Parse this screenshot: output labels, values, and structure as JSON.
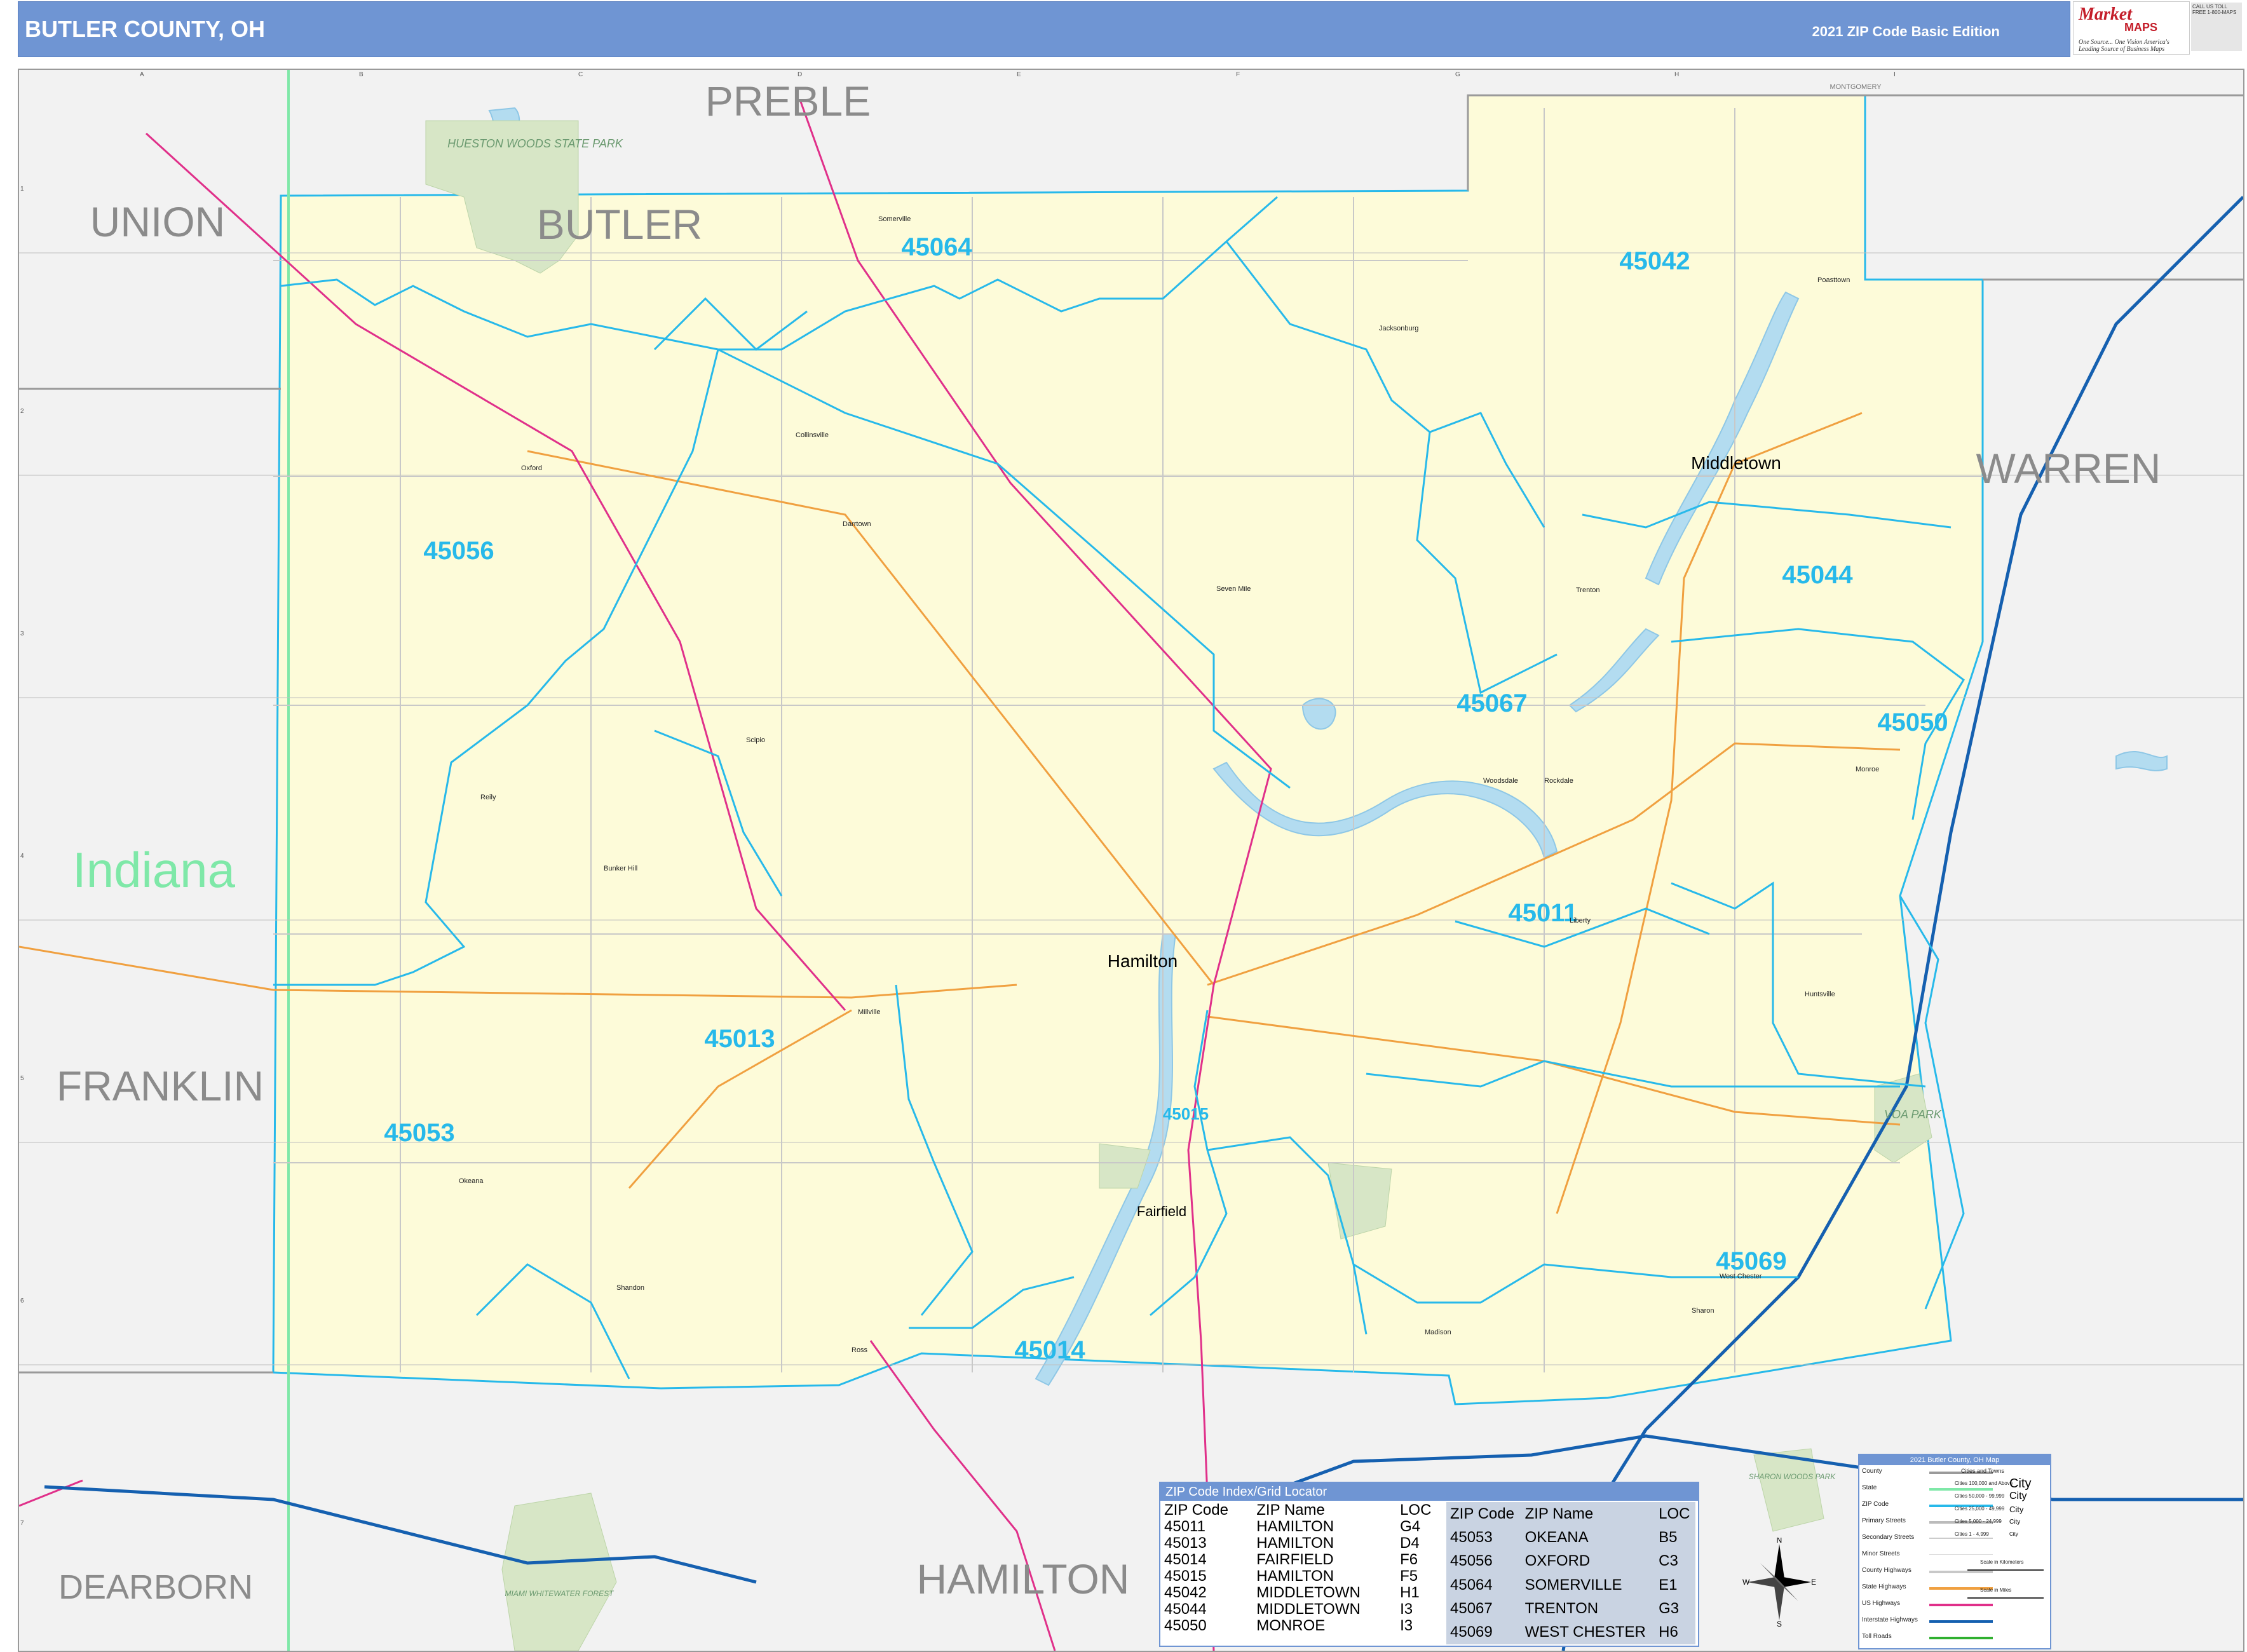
{
  "header": {
    "title": "BUTLER COUNTY, OH",
    "edition": "2021 ZIP Code Basic Edition"
  },
  "logo": {
    "brand_letter": "Market",
    "brand_maps": "MAPS",
    "tagline": "One Source... One Vision",
    "subline": "America's Leading Source of Business Maps",
    "contact": "CALL US TOLL FREE 1-800-MAPS"
  },
  "map": {
    "background_color": "#f2f2f2",
    "county_fill": "#fdfbd9",
    "zip_line_color": "#27b9ea",
    "water_color": "#b3dcf0",
    "park_color": "#d7e6c6",
    "counties": {
      "preble": "PREBLE",
      "union": "UNION",
      "butler": "BUTLER",
      "warren": "WARREN",
      "franklin": "FRANKLIN",
      "dearborn": "DEARBORN",
      "hamilton": "HAMILTON",
      "montgomery": "MONTGOMERY"
    },
    "state": "Indiana",
    "zips": [
      "45064",
      "45042",
      "45056",
      "45044",
      "45067",
      "45050",
      "45011",
      "45013",
      "45053",
      "45015",
      "45069",
      "45014"
    ],
    "cities": {
      "hamilton": "Hamilton",
      "middletown": "Middletown",
      "fairfield": "Fairfield"
    },
    "towns": [
      "Oxford",
      "Somerville",
      "Trenton",
      "Monroe",
      "West Chester",
      "Seven Mile",
      "Millville",
      "Shandon",
      "Okeana",
      "Ross",
      "Darrtown",
      "Collinsville",
      "Jacksonburg",
      "Madison",
      "Liberty",
      "Bunker Hill",
      "Reily",
      "Scipio",
      "Poasttown",
      "Huntsville",
      "Sharon",
      "Woodsdale",
      "Rockdale"
    ],
    "parks": {
      "hueston": "HUESTON WOODS STATE PARK",
      "voa": "VOA PARK",
      "sharon": "SHARON WOODS PARK",
      "miami": "MIAMI WHITEWATER FOREST"
    },
    "grid_letters": [
      "A",
      "B",
      "C",
      "D",
      "E",
      "F",
      "G",
      "H",
      "I"
    ],
    "grid_numbers": [
      "1",
      "2",
      "3",
      "4",
      "5",
      "6",
      "7"
    ]
  },
  "zip_index": {
    "title": "ZIP Code Index/Grid Locator",
    "headers": [
      "ZIP Code",
      "ZIP Name",
      "LOC"
    ],
    "left": [
      [
        "45011",
        "HAMILTON",
        "G4"
      ],
      [
        "45013",
        "HAMILTON",
        "D4"
      ],
      [
        "45014",
        "FAIRFIELD",
        "F6"
      ],
      [
        "45015",
        "HAMILTON",
        "F5"
      ],
      [
        "45042",
        "MIDDLETOWN",
        "H1"
      ],
      [
        "45044",
        "MIDDLETOWN",
        "I3"
      ],
      [
        "45050",
        "MONROE",
        "I3"
      ]
    ],
    "right": [
      [
        "45053",
        "OKEANA",
        "B5"
      ],
      [
        "45056",
        "OXFORD",
        "C3"
      ],
      [
        "45064",
        "SOMERVILLE",
        "E1"
      ],
      [
        "45067",
        "TRENTON",
        "G3"
      ],
      [
        "45069",
        "WEST CHESTER",
        "H6"
      ]
    ]
  },
  "legend": {
    "title": "2021 Butler County, OH Map",
    "rows": [
      "County",
      "State",
      "ZIP Code",
      "Primary Streets",
      "Secondary Streets",
      "Minor Streets",
      "County Highways",
      "State Highways",
      "US Highways",
      "Interstate Highways",
      "Toll Roads"
    ],
    "cities_header": "Cities and Towns",
    "city_tiers": [
      "Cities 100,000 and Above",
      "Cities 50,000 - 99,999",
      "Cities 25,000 - 49,999",
      "Cities 5,000 - 24,999",
      "Cities 1 - 4,999"
    ],
    "city_demos": [
      "City",
      "City",
      "City",
      "City",
      "City"
    ],
    "scale_km": "Scale in Kilometers",
    "scale_mi": "Scale in Miles",
    "colors": {
      "county": "#9a9a9a",
      "state": "#7fe8a8",
      "zip": "#27b9ea",
      "county_hwy": "#c8c8c8",
      "state_hwy": "#f0a040",
      "us_hwy": "#e0308a",
      "interstate": "#1560b0",
      "toll": "#30b030"
    }
  },
  "compass": {
    "n": "N",
    "s": "S",
    "e": "E",
    "w": "W"
  }
}
